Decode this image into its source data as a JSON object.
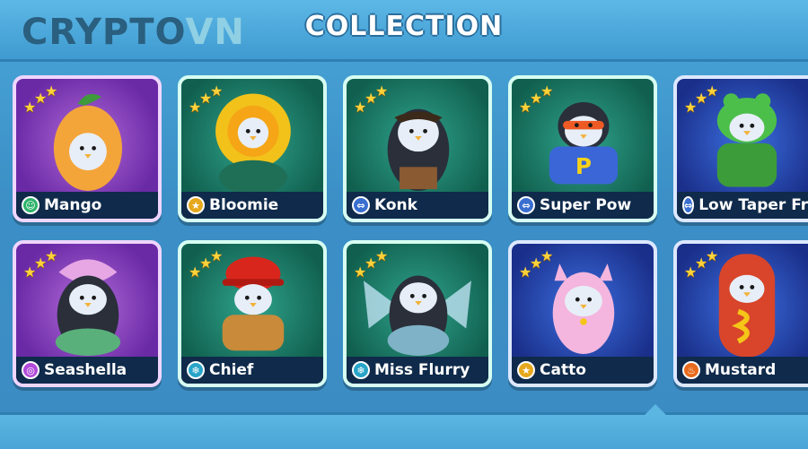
{
  "brand": {
    "part1": "CRYPTO",
    "part2": "VN"
  },
  "header": {
    "title": "COLLECTION"
  },
  "colors": {
    "purple": "#6a2aa6",
    "teal": "#11604f",
    "blue": "#1a2f8a",
    "star": "#ffd23a"
  },
  "cards": [
    {
      "name": "Mango",
      "badge_icon": "mask-icon",
      "stars": 3,
      "theme": "purple"
    },
    {
      "name": "Bloomie",
      "badge_icon": "star-icon",
      "stars": 3,
      "theme": "teal"
    },
    {
      "name": "Konk",
      "badge_icon": "dumbbell-icon",
      "stars": 3,
      "theme": "teal"
    },
    {
      "name": "Super Pow",
      "badge_icon": "dumbbell-icon",
      "stars": 3,
      "theme": "teal"
    },
    {
      "name": "Low Taper Fro",
      "badge_icon": "dumbbell-icon",
      "stars": 3,
      "theme": "blue"
    },
    {
      "name": "Seashella",
      "badge_icon": "spiral-icon",
      "stars": 3,
      "theme": "purple"
    },
    {
      "name": "Chief",
      "badge_icon": "snowflake-icon",
      "stars": 3,
      "theme": "teal"
    },
    {
      "name": "Miss Flurry",
      "badge_icon": "snowflake-icon",
      "stars": 3,
      "theme": "teal"
    },
    {
      "name": "Catto",
      "badge_icon": "star-icon",
      "stars": 3,
      "theme": "blue"
    },
    {
      "name": "Mustard",
      "badge_icon": "flame-icon",
      "stars": 3,
      "theme": "blue"
    }
  ]
}
